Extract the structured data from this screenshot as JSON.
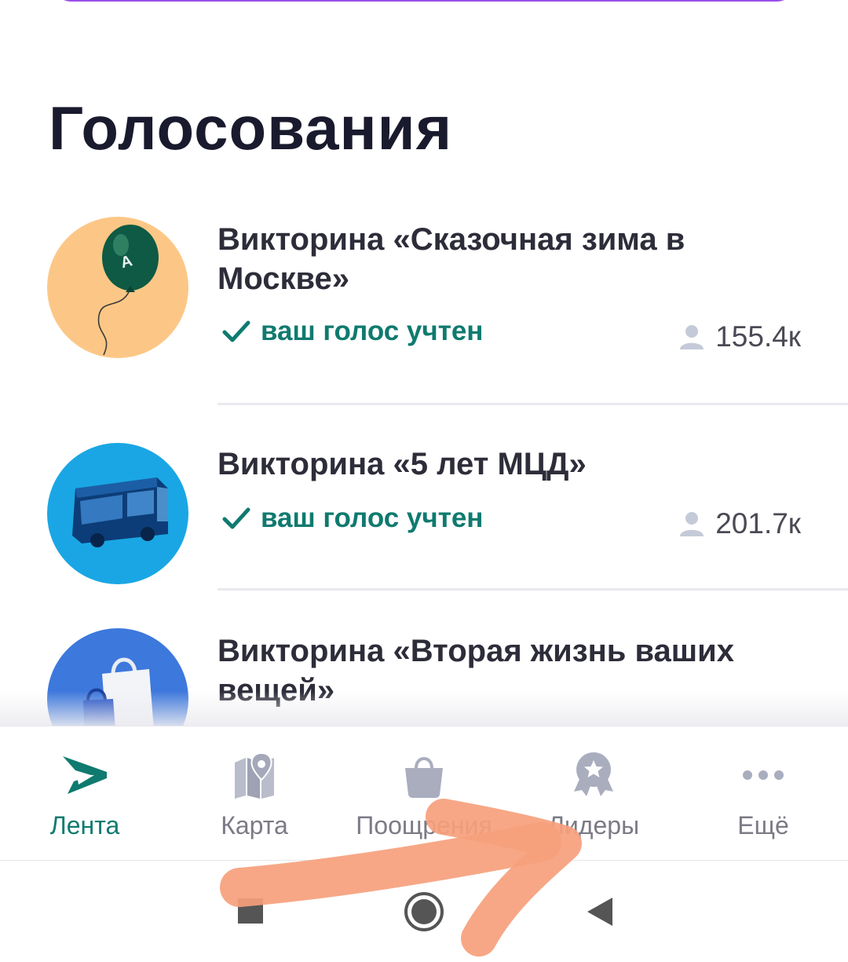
{
  "section": {
    "title": "Голосования"
  },
  "votes": [
    {
      "title": "Викторина «Сказочная зима в Москве»",
      "status": "ваш голос учтен",
      "count": "155.4к",
      "thumb_bg": "#fcc786"
    },
    {
      "title": "Викторина «5 лет МЦД»",
      "status": "ваш голос учтен",
      "count": "201.7к",
      "thumb_bg": "#1aa6e4"
    },
    {
      "title": "Викторина «Вторая жизнь ваших вещей»",
      "thumb_bg": "#3d78dc"
    }
  ],
  "tabbar": {
    "items": [
      {
        "label": "Лента",
        "icon": "feed-logo-icon",
        "active": true
      },
      {
        "label": "Карта",
        "icon": "map-icon",
        "active": false
      },
      {
        "label": "Поощрения",
        "icon": "shopping-bag-icon",
        "active": false
      },
      {
        "label": "Лидеры",
        "icon": "medal-icon",
        "active": false
      },
      {
        "label": "Ещё",
        "icon": "more-dots-icon",
        "active": false
      }
    ]
  },
  "colors": {
    "accent": "#0f7a6f",
    "inactive": "#7b7b86",
    "annotation_arrow": "#f6a07c"
  }
}
